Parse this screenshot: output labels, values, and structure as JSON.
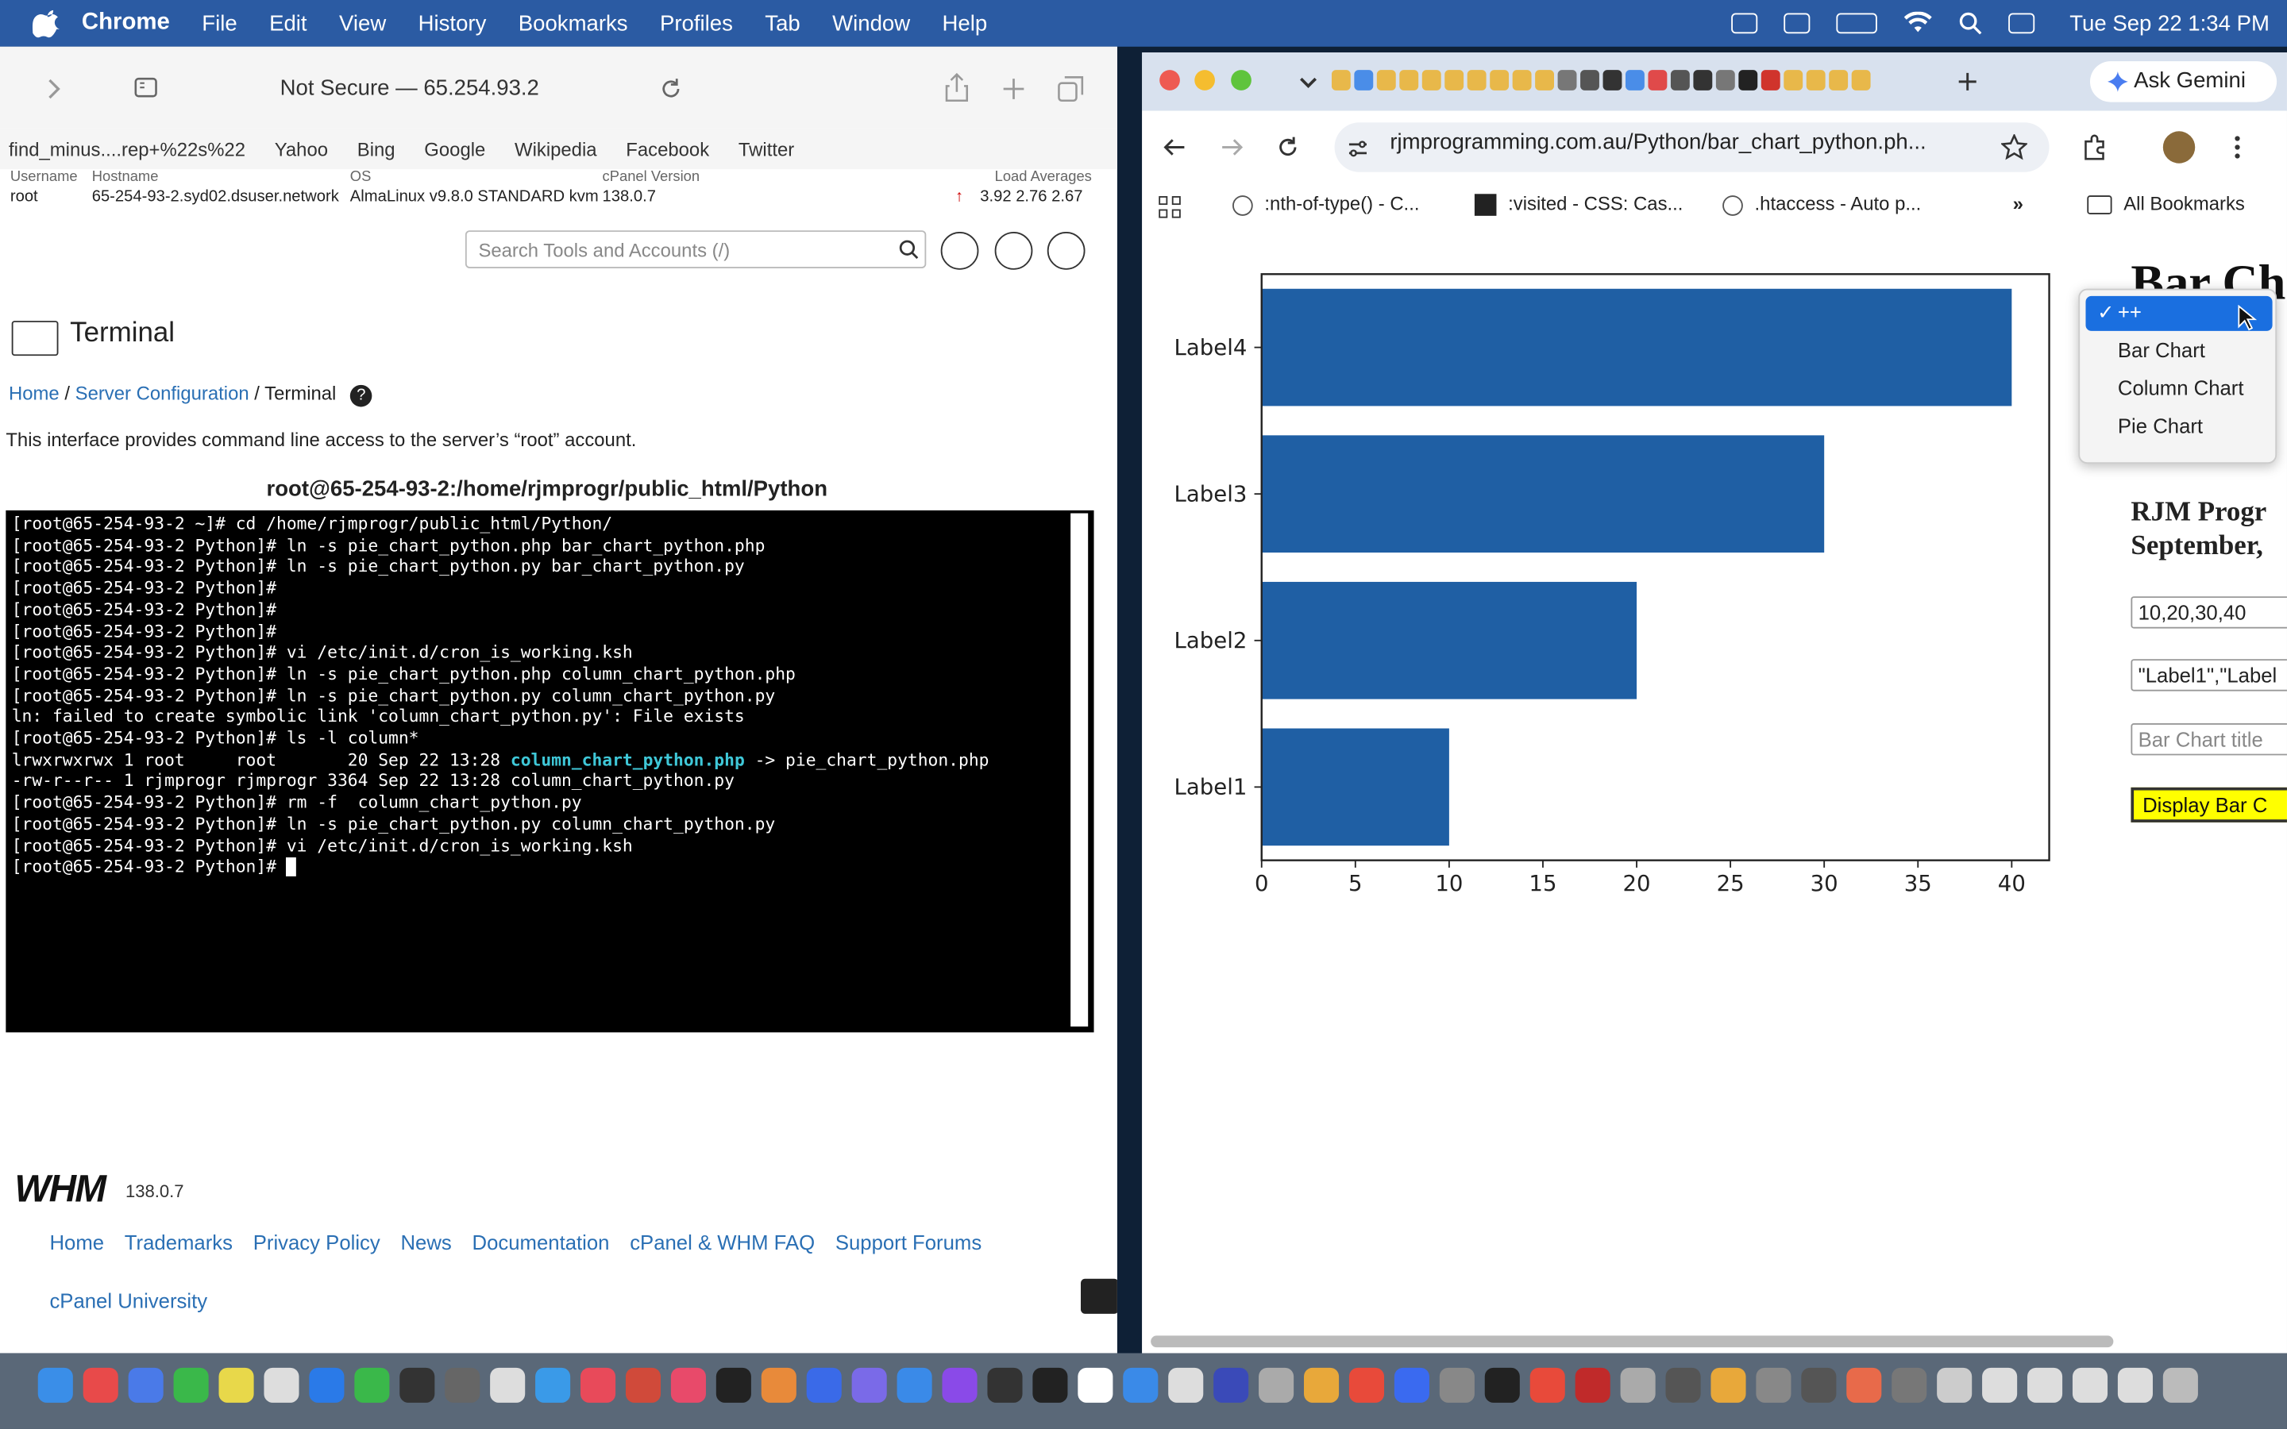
{
  "menubar": {
    "app": "Chrome",
    "items": [
      "File",
      "Edit",
      "View",
      "History",
      "Bookmarks",
      "Profiles",
      "Tab",
      "Window",
      "Help"
    ],
    "clock": "Tue Sep 22  1:34 PM"
  },
  "safari": {
    "address": "Not Secure — 65.254.93.2",
    "favorites": [
      "find_minus....rep+%22s%22",
      "Yahoo",
      "Bing",
      "Google",
      "Wikipedia",
      "Facebook",
      "Twitter"
    ],
    "info": {
      "username_label": "Username",
      "username": "root",
      "hostname_label": "Hostname",
      "hostname": "65-254-93-2.syd02.dsuser.network",
      "os_label": "OS",
      "os": "AlmaLinux v9.8.0 STANDARD kvm",
      "cpanel_label": "cPanel Version",
      "cpanel": "138.0.7",
      "load_label": "Load Averages",
      "load": "3.92  2.76  2.67"
    },
    "search_placeholder": "Search Tools and Accounts (/)",
    "page_title": "Terminal",
    "crumbs": {
      "home": "Home",
      "sep": " / ",
      "server": "Server Configuration",
      "current": "Terminal"
    },
    "description": "This interface provides command line access to the server’s “root” account.",
    "cwd": "root@65-254-93-2:/home/rjmprogr/public_html/Python",
    "terminal": {
      "lines": [
        "[root@65-254-93-2 ~]# cd /home/rjmprogr/public_html/Python/",
        "[root@65-254-93-2 Python]# ln -s pie_chart_python.php bar_chart_python.php",
        "[root@65-254-93-2 Python]# ln -s pie_chart_python.py bar_chart_python.py",
        "[root@65-254-93-2 Python]#",
        "[root@65-254-93-2 Python]#",
        "[root@65-254-93-2 Python]#",
        "[root@65-254-93-2 Python]# vi /etc/init.d/cron_is_working.ksh",
        "[root@65-254-93-2 Python]# ln -s pie_chart_python.php column_chart_python.php",
        "[root@65-254-93-2 Python]# ln -s pie_chart_python.py column_chart_python.py",
        "ln: failed to create symbolic link 'column_chart_python.py': File exists",
        "[root@65-254-93-2 Python]# ls -l column*"
      ],
      "ls_line1_pre": "lrwxrwxrwx 1 root     root       20 Sep 22 13:28 ",
      "ls_line1_hl": "column_chart_python.php",
      "ls_line1_post": " -> pie_chart_python.php",
      "lines2": [
        "-rw-r--r-- 1 rjmprogr rjmprogr 3364 Sep 22 13:28 column_chart_python.py",
        "[root@65-254-93-2 Python]# rm -f  column_chart_python.py",
        "[root@65-254-93-2 Python]# ln -s pie_chart_python.py column_chart_python.py",
        "[root@65-254-93-2 Python]# vi /etc/init.d/cron_is_working.ksh"
      ],
      "prompt": "[root@65-254-93-2 Python]# "
    },
    "whm_logo": "WHM",
    "whm_version": "138.0.7",
    "footer": [
      "Home",
      "Trademarks",
      "Privacy Policy",
      "News",
      "Documentation",
      "cPanel & WHM FAQ",
      "Support Forums"
    ],
    "footer2": "cPanel University"
  },
  "chrome": {
    "gemini": "Ask Gemini",
    "url": "rjmprogramming.com.au/Python/bar_chart_python.ph...",
    "bookmarks": [
      ":nth-of-type() - C...",
      ":visited - CSS: Cas...",
      ".htaccess - Auto p..."
    ],
    "all_bookmarks": "All Bookmarks",
    "page": {
      "heading": "Bar Ch",
      "dropdown": [
        "++",
        "Bar Chart",
        "Column Chart",
        "Pie Chart"
      ],
      "subhead1": "RJM Progr",
      "subhead2": "September,",
      "values_input": "10,20,30,40",
      "labels_input": "\"Label1\",\"Label",
      "title_placeholder": "Bar Chart title",
      "display_button": "Display Bar C"
    }
  },
  "chart_data": {
    "type": "bar",
    "orientation": "horizontal",
    "categories": [
      "Label1",
      "Label2",
      "Label3",
      "Label4"
    ],
    "values": [
      10,
      20,
      30,
      40
    ],
    "xlim": [
      0,
      42
    ],
    "xticks": [
      0,
      5,
      10,
      15,
      20,
      25,
      30,
      35,
      40
    ],
    "bar_color": "#1f5fa4"
  }
}
